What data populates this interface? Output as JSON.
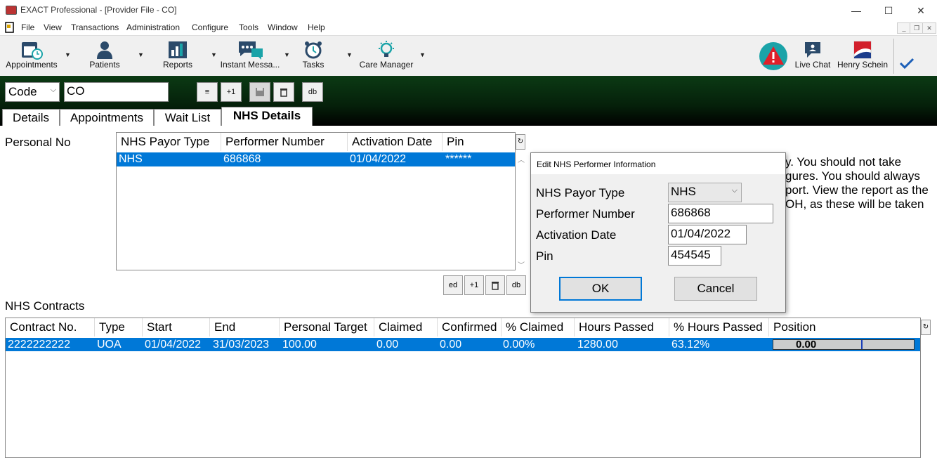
{
  "window": {
    "title": "EXACT Professional - [Provider File - CO]",
    "minimize": "—",
    "maximize": "☐",
    "close": "✕"
  },
  "menu": [
    "File",
    "View",
    "Transactions",
    "Administration",
    "Configure",
    "Tools",
    "Window",
    "Help"
  ],
  "toolbar": {
    "appointments": "Appointments",
    "patients": "Patients",
    "reports": "Reports",
    "instant_messaging": "Instant Messa...",
    "tasks": "Tasks",
    "care_manager": "Care Manager",
    "live_chat": "Live Chat",
    "henry_schein": "Henry Schein"
  },
  "search": {
    "field_select": "Code",
    "value": "CO",
    "btn_align": "≡",
    "btn_plus1": "+1",
    "btn_db": "db"
  },
  "tabs": [
    "Details",
    "Appointments",
    "Wait List",
    "NHS Details"
  ],
  "personal_no_label": "Personal No",
  "performer_grid": {
    "headers": [
      "NHS Payor Type",
      "Performer Number",
      "Activation Date",
      "Pin"
    ],
    "rows": [
      [
        "NHS",
        "686868",
        "01/04/2022",
        "******"
      ]
    ],
    "btn_edit": "ed",
    "btn_plus1": "+1",
    "btn_db": "db"
  },
  "notice_lines": [
    "y. You should not take",
    "gures. You should always",
    "port. View the report as the",
    "OH, as these will be taken"
  ],
  "contracts": {
    "label": "NHS Contracts",
    "headers": [
      "Contract No.",
      "Type",
      "Start",
      "End",
      "Personal Target",
      "Claimed",
      "Confirmed",
      "% Claimed",
      "Hours Passed",
      "% Hours Passed",
      "Position"
    ],
    "rows": [
      [
        "2222222222",
        "UOA",
        "01/04/2022",
        "31/03/2023",
        "100.00",
        "0.00",
        "0.00",
        "0.00%",
        "1280.00",
        "63.12%",
        "0.00"
      ]
    ]
  },
  "dialog": {
    "title": "Edit NHS Performer Information",
    "payor_type_label": "NHS Payor Type",
    "payor_type_value": "NHS",
    "performer_number_label": "Performer Number",
    "performer_number_value": "686868",
    "activation_date_label": "Activation Date",
    "activation_date_value": "01/04/2022",
    "pin_label": "Pin",
    "pin_value": "454545",
    "ok": "OK",
    "cancel": "Cancel"
  },
  "colors": {
    "selection": "#0078d7",
    "strip": "#0b3a14",
    "alert": "#e0202a",
    "teal": "#1aa3a8"
  }
}
